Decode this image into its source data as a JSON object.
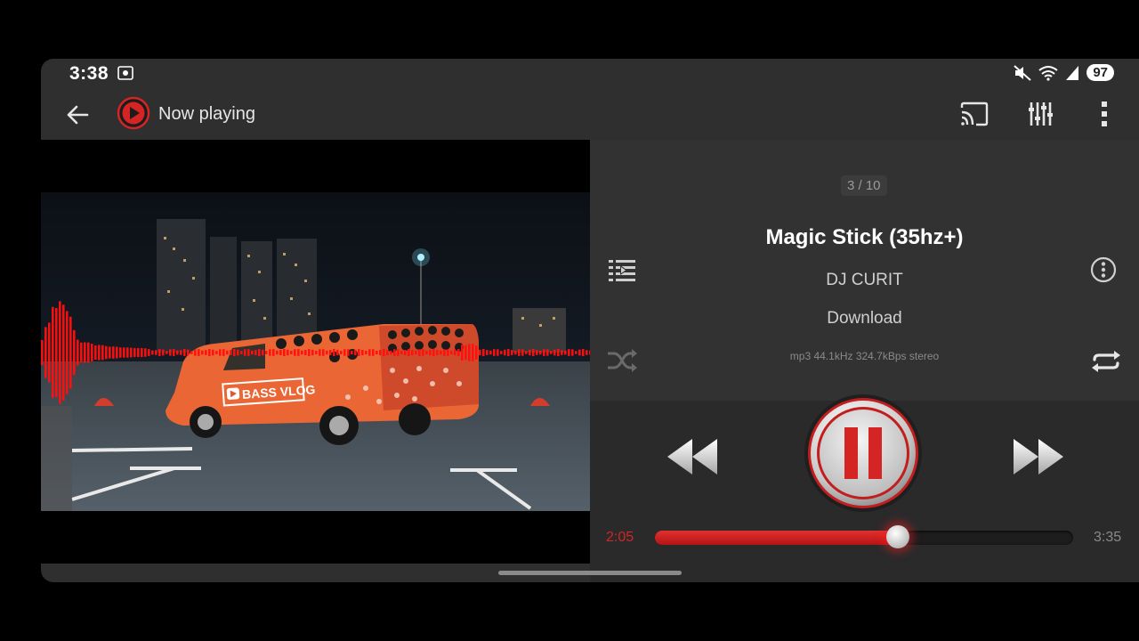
{
  "status_bar": {
    "time": "3:38",
    "battery": "97",
    "icons": [
      "screen-record-icon",
      "mute-icon",
      "wifi-icon",
      "signal-icon"
    ]
  },
  "header": {
    "title": "Now playing",
    "icons": [
      "back-arrow-icon",
      "app-logo-icon",
      "cast-icon",
      "equalizer-icon",
      "more-vert-icon"
    ]
  },
  "artwork": {
    "car_label": "BASS VLOG"
  },
  "track": {
    "counter": "3 / 10",
    "title": "Magic Stick (35hz+)",
    "artist": "DJ CURIT",
    "album": "Download",
    "format": "mp3 44.1kHz 324.7kBps stereo"
  },
  "progress": {
    "elapsed": "2:05",
    "duration": "3:35",
    "fraction": 0.58
  },
  "state": {
    "playing": true
  },
  "colors": {
    "accent": "#d42424",
    "background": "#2f2f30"
  }
}
